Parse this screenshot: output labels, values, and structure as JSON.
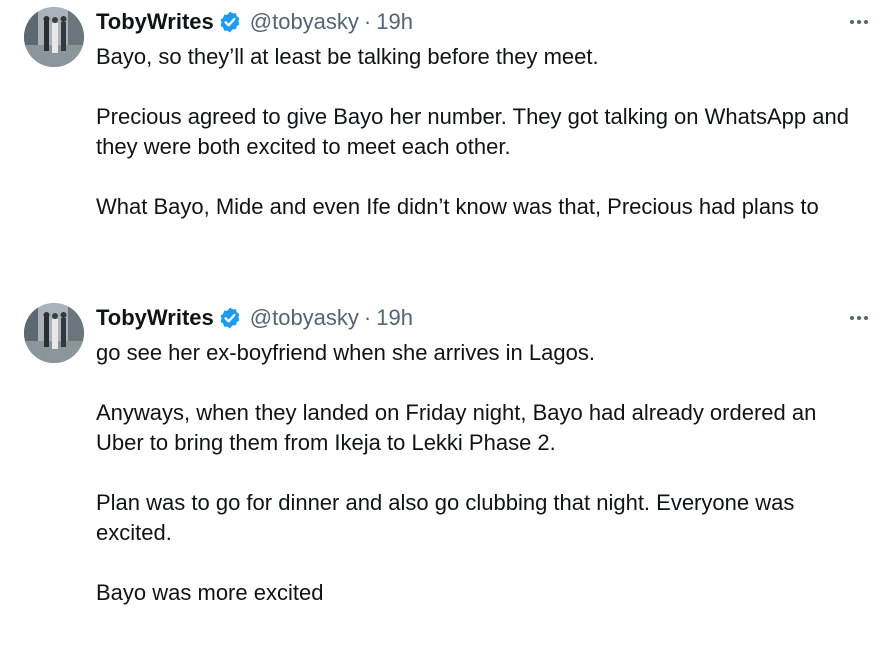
{
  "tweets": [
    {
      "author_name": "TobyWrites",
      "handle": "@tobyasky",
      "separator": "·",
      "time": "19h",
      "verified_icon": "verified-badge-icon",
      "more_icon": "more-options-icon",
      "paragraphs": [
        "Bayo, so they’ll at least be talking before they meet.",
        "Precious agreed to give Bayo her number. They got talking on WhatsApp and they were both excited to meet each other.",
        "What Bayo, Mide and even Ife didn’t know was that, Precious had plans to"
      ]
    },
    {
      "author_name": "TobyWrites",
      "handle": "@tobyasky",
      "separator": "·",
      "time": "19h",
      "verified_icon": "verified-badge-icon",
      "more_icon": "more-options-icon",
      "paragraphs": [
        "go see her ex-boyfriend when she arrives in Lagos.",
        "Anyways, when they landed on Friday night, Bayo had already ordered an Uber to bring them from Ikeja to Lekki Phase 2.",
        "Plan was to go for dinner and also go clubbing that night. Everyone was excited.",
        "Bayo was more excited"
      ]
    }
  ],
  "colors": {
    "text": "#0f1419",
    "secondary": "#536471",
    "verified": "#1d9bf0"
  }
}
